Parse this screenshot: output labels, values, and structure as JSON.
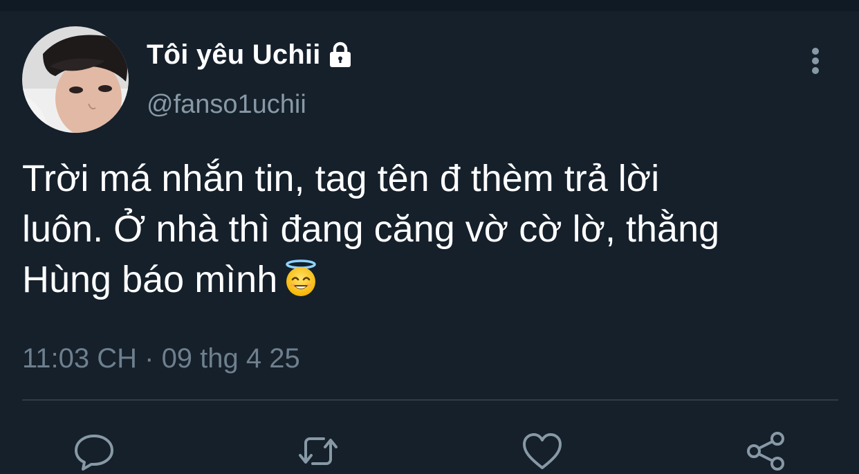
{
  "tweet": {
    "display_name": "Tôi yêu Uchii",
    "handle": "@fanso1uchii",
    "text_lines": [
      "Trời má nhắn tin, tag tên đ thèm trả lời",
      "luôn. Ở nhà thì đang căng vờ cờ lờ, thằng",
      "Hùng báo mình"
    ],
    "emoji": "smiling-face-with-halo",
    "timestamp": "11:03 CH · 09 thg 4 25",
    "protected_icon": "lock-icon"
  },
  "actions": [
    {
      "name": "reply",
      "icon": "comment-icon"
    },
    {
      "name": "retweet",
      "icon": "retweet-icon"
    },
    {
      "name": "like",
      "icon": "heart-icon"
    },
    {
      "name": "share",
      "icon": "share-icon"
    }
  ],
  "colors": {
    "background": "#15202b",
    "secondary_text": "#8899a6",
    "timestamp_text": "#6e7f8d",
    "divider": "#2f3d4a",
    "icon": "#8899a6"
  }
}
